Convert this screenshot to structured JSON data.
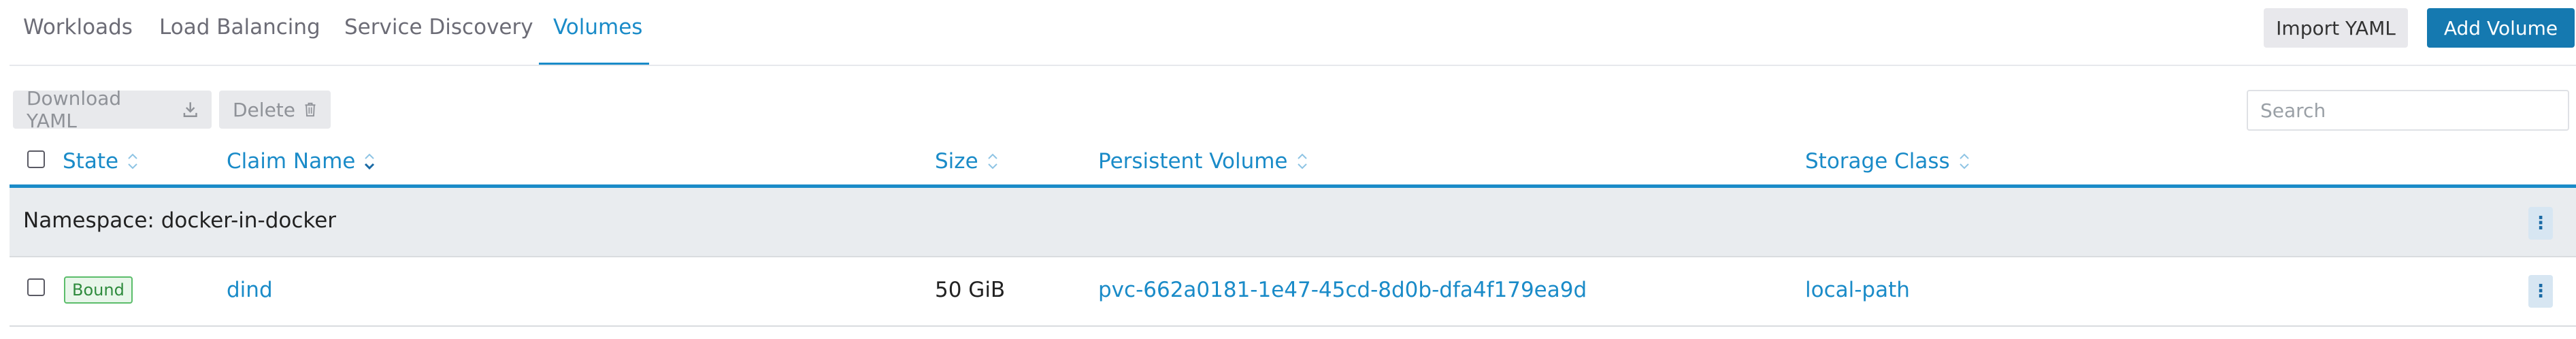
{
  "tabs": [
    {
      "label": "Workloads"
    },
    {
      "label": "Load Balancing"
    },
    {
      "label": "Service Discovery"
    },
    {
      "label": "Volumes"
    }
  ],
  "active_tab": "Volumes",
  "header": {
    "import_yaml_label": "Import YAML",
    "add_volume_label": "Add Volume"
  },
  "bulk_actions": {
    "download_yaml_label": "Download YAML",
    "delete_label": "Delete"
  },
  "search": {
    "placeholder": "Search",
    "value": ""
  },
  "table": {
    "columns": [
      "State",
      "Claim Name",
      "Size",
      "Persistent Volume",
      "Storage Class"
    ],
    "sorted_column": "Claim Name",
    "groups": [
      {
        "label": "Namespace: docker-in-docker",
        "rows": [
          {
            "state": "Bound",
            "claim_name": "dind",
            "size": "50 GiB",
            "persistent_volume": "pvc-662a0181-1e47-45cd-8d0b-dfa4f179ea9d",
            "storage_class": "local-path"
          }
        ]
      }
    ]
  },
  "colors": {
    "accent": "#1a8bc8",
    "primary_button": "#1579b0",
    "bound_badge": "#2e8b3d"
  }
}
